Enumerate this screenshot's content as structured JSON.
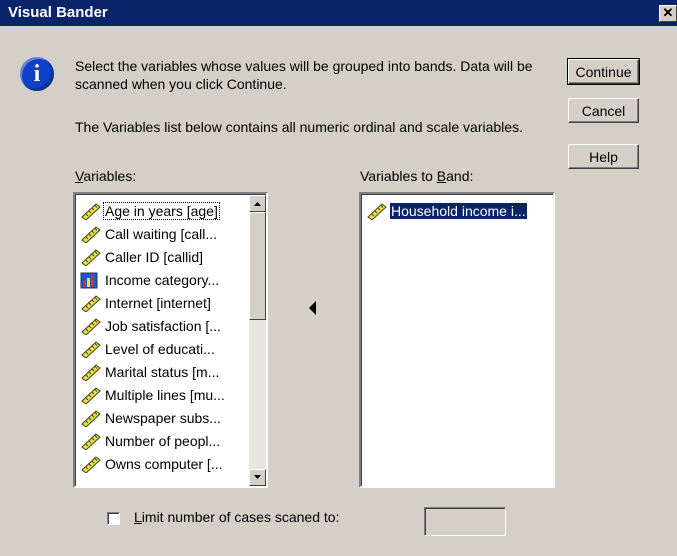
{
  "window": {
    "title": "Visual Bander",
    "close_glyph": "✕"
  },
  "info": {
    "icon_glyph": "i",
    "paragraph1": "Select the variables whose values will be grouped into bands.  Data will be scanned when you click Continue.",
    "paragraph2": "The Variables list below contains all numeric ordinal and scale variables."
  },
  "buttons": {
    "continue": "Continue",
    "cancel": "Cancel",
    "help": "Help"
  },
  "variables": {
    "label_underlined": "V",
    "label_rest": "ariables:",
    "items": [
      {
        "label": "Age in years [age]",
        "icon": "scale-ruler-icon"
      },
      {
        "label": "Call waiting [call...",
        "icon": "scale-ruler-icon"
      },
      {
        "label": "Caller ID [callid]",
        "icon": "scale-ruler-icon"
      },
      {
        "label": "Income category...",
        "icon": "ordinal-bars-icon"
      },
      {
        "label": "Internet [internet]",
        "icon": "scale-ruler-icon"
      },
      {
        "label": "Job satisfaction [...",
        "icon": "scale-ruler-icon"
      },
      {
        "label": "Level of educati...",
        "icon": "scale-ruler-icon"
      },
      {
        "label": "Marital status [m...",
        "icon": "scale-ruler-icon"
      },
      {
        "label": "Multiple lines [mu...",
        "icon": "scale-ruler-icon"
      },
      {
        "label": "Newspaper subs...",
        "icon": "scale-ruler-icon"
      },
      {
        "label": "Number of peopl...",
        "icon": "scale-ruler-icon"
      },
      {
        "label": "Owns computer [...",
        "icon": "scale-ruler-icon"
      }
    ]
  },
  "to_band": {
    "label_pre": "Variables to ",
    "label_underlined": "B",
    "label_rest": "and:",
    "items": [
      {
        "label": "Household income i...",
        "icon": "scale-ruler-icon",
        "selected": true
      }
    ]
  },
  "move_arrow": "move-left-arrow-icon",
  "limit": {
    "checked": false,
    "label_underlined": "L",
    "label_rest": "imit number of cases scaned to:",
    "value": ""
  }
}
